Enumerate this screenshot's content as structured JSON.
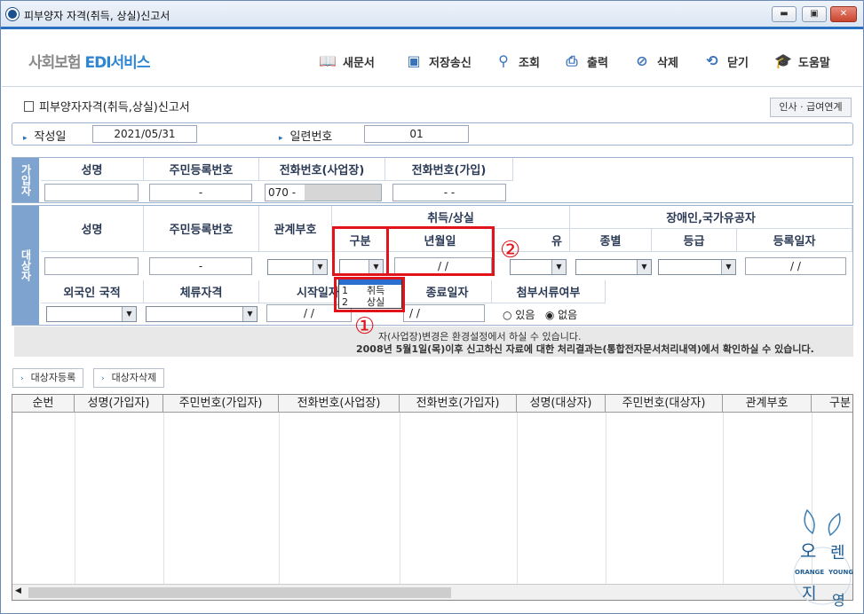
{
  "window": {
    "title": "피부양자 자격(취득, 상실)신고서",
    "min": "▬",
    "max": "▣",
    "close": "✕"
  },
  "toolbar": {
    "logo_gray": "사회보험 ",
    "logo_blue": "EDI서비스",
    "buttons": [
      {
        "label": "새문서",
        "icon": "book-icon"
      },
      {
        "label": "저장송신",
        "icon": "save-icon"
      },
      {
        "label": "조회",
        "icon": "search-icon"
      },
      {
        "label": "출력",
        "icon": "print-icon"
      },
      {
        "label": "삭제",
        "icon": "delete-icon"
      },
      {
        "label": "닫기",
        "icon": "power-icon"
      },
      {
        "label": "도움말",
        "icon": "help-cap-icon"
      }
    ]
  },
  "form": {
    "title": "피부양자자격(취득,상실)신고서",
    "link_button": "인사 · 급여연계",
    "write_date_label": "작성일",
    "write_date_value": "2021/05/31",
    "serial_label": "일련번호",
    "serial_value": "01"
  },
  "subscriber": {
    "side_label": "가입자",
    "headers": [
      "성명",
      "주민등록번호",
      "전화번호(사업장)",
      "전화번호(가입)"
    ],
    "jumin_value": "-",
    "phone_biz_value": "070 -",
    "phone_join_value": "-          -"
  },
  "target": {
    "side_label": "대상자",
    "h_name": "성명",
    "h_jumin": "주민등록번호",
    "h_relation": "관계부호",
    "h_acq_loss": "취득/상실",
    "h_gubun": "구분",
    "h_ymd": "년월일",
    "h_reason_partial": "유",
    "h_disabled": "장애인,국가유공자",
    "h_type": "종별",
    "h_grade": "등급",
    "h_regdate": "등록일자",
    "jumin_value": "-",
    "ymd_value": "/   /",
    "regdate_value": "/   /",
    "h_foreign": "외국인 국적",
    "h_stay": "체류자격",
    "h_start": "시작일자",
    "h_end": "종료일자",
    "h_attach": "첨부서류여부",
    "start_value": "/   /",
    "end_value": "/   /",
    "radio_yes": "있음",
    "radio_no": "없음",
    "dropdown_options": [
      {
        "code": "1",
        "label": "취득"
      },
      {
        "code": "2",
        "label": "상실"
      }
    ]
  },
  "notice": {
    "line1": "자(사업장)변경은 환경설정에서 하실 수 있습니다.",
    "line2": "2008년 5월1일(목)이후 신고하신 자료에 대한 처리결과는(통합전자문서처리내역)에서 확인하실 수 있습니다."
  },
  "actions": {
    "register": "대상자등록",
    "delete": "대상자삭제"
  },
  "grid": {
    "columns": [
      "순번",
      "성명(가입자)",
      "주민번호(가입자)",
      "전화번호(사업장)",
      "전화번호(가입자)",
      "성명(대상자)",
      "주민번호(대상자)",
      "관계부호",
      "구분"
    ]
  },
  "annotations": {
    "circle1": "①",
    "circle2": "②"
  },
  "watermark": {
    "line1": "오",
    "line2": "렌",
    "line3": "지",
    "line4": "영",
    "brand1": "ORANGE",
    "brand2": "YOUNG"
  }
}
